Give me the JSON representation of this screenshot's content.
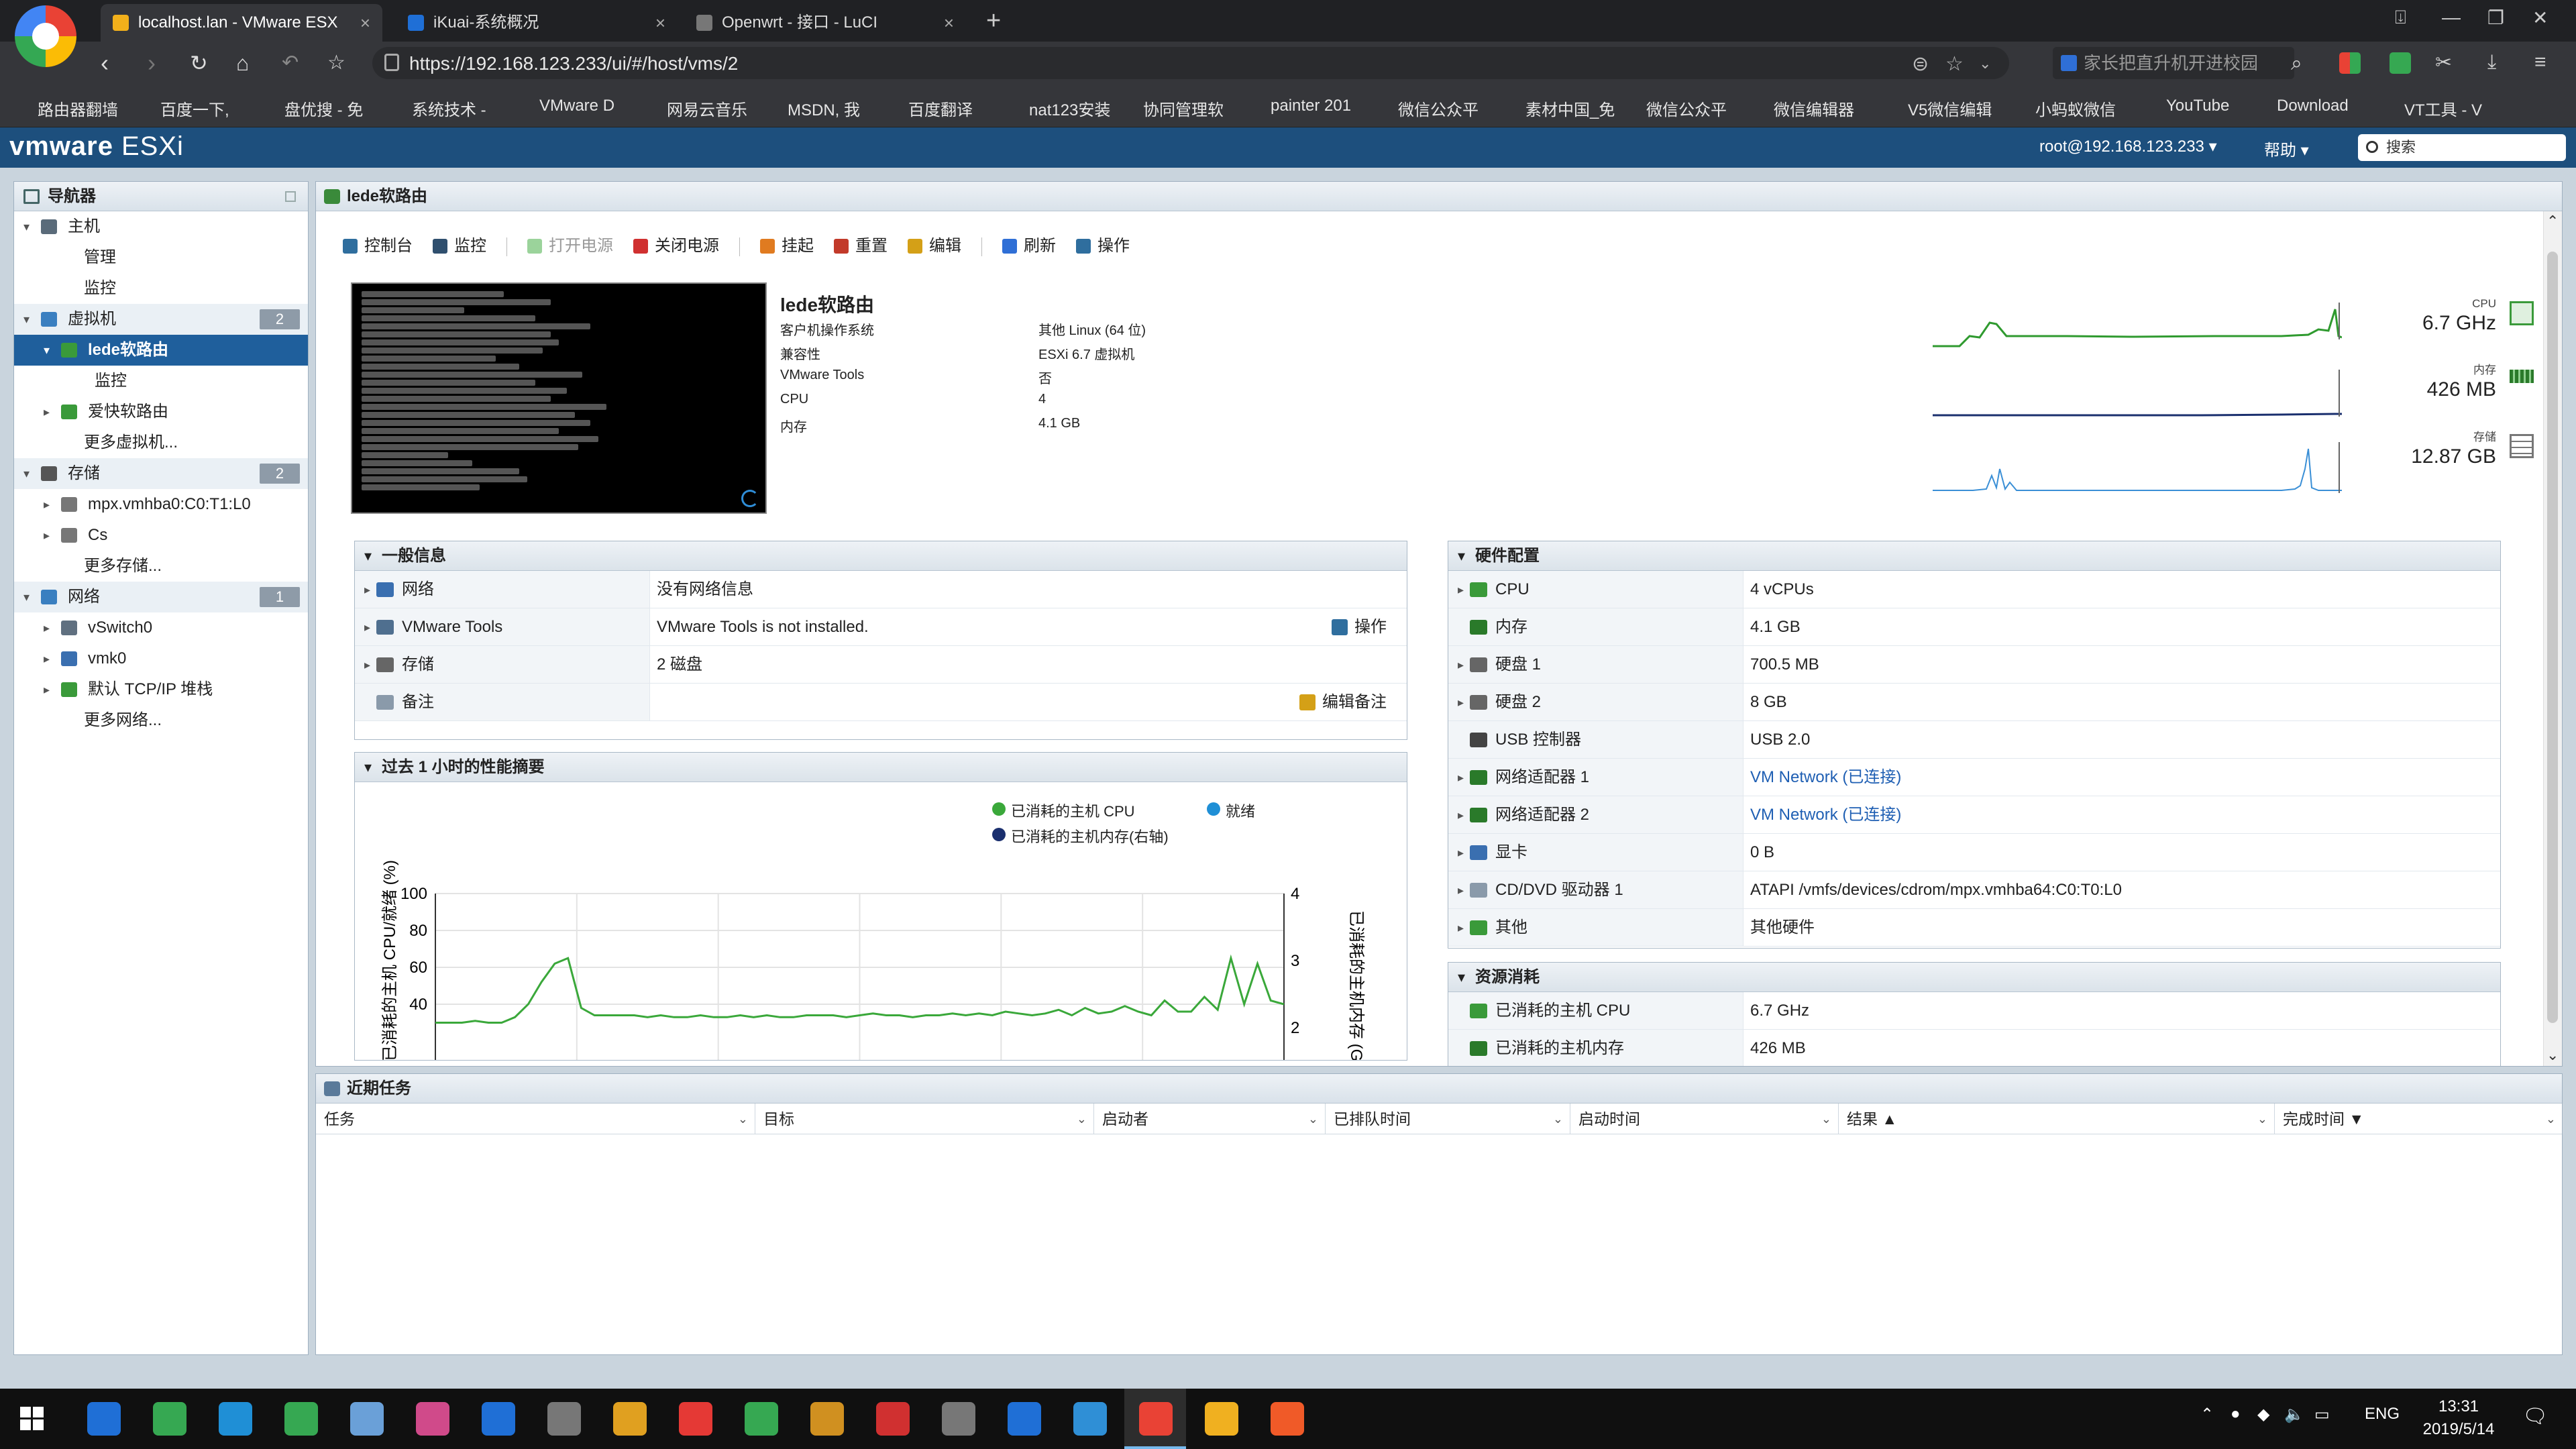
{
  "browser": {
    "tabs": [
      {
        "label": "localhost.lan - VMware ESX",
        "active": true
      },
      {
        "label": "iKuai-系统概况",
        "active": false
      },
      {
        "label": "Openwrt - 接口 - LuCI",
        "active": false
      }
    ],
    "url": "https://192.168.123.233/ui/#/host/vms/2",
    "search_placeholder": "家长把直升机开进校园",
    "bookmarks": [
      "路由器翻墙",
      "百度一下,",
      "盘优搜 - 免",
      "系统技术 -",
      "VMware D",
      "网易云音乐",
      "MSDN, 我",
      "百度翻译",
      "nat123安装",
      "协同管理软",
      "painter 201",
      "微信公众平",
      "素材中国_免",
      "微信公众平",
      "微信编辑器",
      "V5微信编辑",
      "小蚂蚁微信",
      "YouTube",
      "Download",
      "VT工具 - V"
    ],
    "bookmark_colors": [
      "#e8e8e8",
      "#2f6fd6",
      "#f2a31b",
      "#2f6fd6",
      "#888888",
      "#d0302f",
      "#f2a31b",
      "#2f6fd6",
      "#36a852",
      "#d0302f",
      "#2f6fd6",
      "#36a852",
      "#36a852",
      "#36a852",
      "#555555",
      "#2f6fd6",
      "#8bc34a",
      "#e53935",
      "#36a852",
      "#cccccc"
    ]
  },
  "esxi": {
    "logo_vm": "vmware",
    "logo_product": "ESXi",
    "user": "root@192.168.123.233 ▾",
    "help": "帮助 ▾",
    "search_placeholder": "搜索"
  },
  "navigator": {
    "title": "导航器",
    "items": [
      {
        "label": "主机",
        "level": 0,
        "arrow": "▾",
        "section": false,
        "badge": "",
        "icon_color": "#5a6b7a"
      },
      {
        "label": "管理",
        "level": 1,
        "arrow": "",
        "section": false,
        "badge": "",
        "icon_color": ""
      },
      {
        "label": "监控",
        "level": 1,
        "arrow": "",
        "section": false,
        "badge": "",
        "icon_color": ""
      },
      {
        "label": "虚拟机",
        "level": 0,
        "arrow": "▾",
        "section": true,
        "badge": "2",
        "icon_color": "#3a7fc0"
      },
      {
        "label": "lede软路由",
        "level": 1,
        "arrow": "▾",
        "section": false,
        "badge": "",
        "icon_color": "#3a9a3a",
        "selected": true
      },
      {
        "label": "监控",
        "level": 2,
        "arrow": "",
        "section": false,
        "badge": "",
        "icon_color": ""
      },
      {
        "label": "爱快软路由",
        "level": 1,
        "arrow": "▸",
        "section": false,
        "badge": "",
        "icon_color": "#3a9a3a"
      },
      {
        "label": "更多虚拟机...",
        "level": 1,
        "arrow": "",
        "section": false,
        "badge": "",
        "icon_color": ""
      },
      {
        "label": "存储",
        "level": 0,
        "arrow": "▾",
        "section": true,
        "badge": "2",
        "icon_color": "#555555"
      },
      {
        "label": "mpx.vmhba0:C0:T1:L0",
        "level": 1,
        "arrow": "▸",
        "section": false,
        "badge": "",
        "icon_color": "#777777"
      },
      {
        "label": "Cs",
        "level": 1,
        "arrow": "▸",
        "section": false,
        "badge": "",
        "icon_color": "#777777"
      },
      {
        "label": "更多存储...",
        "level": 1,
        "arrow": "",
        "section": false,
        "badge": "",
        "icon_color": ""
      },
      {
        "label": "网络",
        "level": 0,
        "arrow": "▾",
        "section": true,
        "badge": "1",
        "icon_color": "#3a7fc0"
      },
      {
        "label": "vSwitch0",
        "level": 1,
        "arrow": "▸",
        "section": false,
        "badge": "",
        "icon_color": "#607080"
      },
      {
        "label": "vmk0",
        "level": 1,
        "arrow": "▸",
        "section": false,
        "badge": "",
        "icon_color": "#3a6fb0"
      },
      {
        "label": "默认 TCP/IP 堆栈",
        "level": 1,
        "arrow": "▸",
        "section": false,
        "badge": "",
        "icon_color": "#3a9a3a"
      },
      {
        "label": "更多网络...",
        "level": 1,
        "arrow": "",
        "section": false,
        "badge": "",
        "icon_color": ""
      }
    ]
  },
  "vm": {
    "panel_title": "lede软路由",
    "actions": [
      {
        "label": "控制台",
        "icon": "console-icon",
        "color": "#2f6e9e",
        "disabled": false
      },
      {
        "label": "监控",
        "icon": "monitor-icon",
        "color": "#2f4f6e",
        "disabled": false
      },
      {
        "label": "打开电源",
        "icon": "power-on-icon",
        "color": "#9bd39b",
        "disabled": true
      },
      {
        "label": "关闭电源",
        "icon": "power-off-icon",
        "color": "#d03030",
        "disabled": false
      },
      {
        "label": "挂起",
        "icon": "suspend-icon",
        "color": "#e07b20",
        "disabled": false
      },
      {
        "label": "重置",
        "icon": "reset-icon",
        "color": "#c23a2a",
        "disabled": false
      },
      {
        "label": "编辑",
        "icon": "edit-icon",
        "color": "#d4a017",
        "disabled": false
      },
      {
        "label": "刷新",
        "icon": "refresh-icon",
        "color": "#2f6fd6",
        "disabled": false
      },
      {
        "label": "操作",
        "icon": "gear-icon",
        "color": "#2f6e9e",
        "disabled": false
      }
    ],
    "name": "lede软路由",
    "properties": [
      {
        "key": "客户机操作系统",
        "value": "其他 Linux (64 位)"
      },
      {
        "key": "兼容性",
        "value": "ESXi 6.7 虚拟机"
      },
      {
        "key": "VMware Tools",
        "value": "否"
      },
      {
        "key": "CPU",
        "value": "4"
      },
      {
        "key": "内存",
        "value": "4.1 GB"
      }
    ],
    "metrics": [
      {
        "label": "CPU",
        "value": "6.7 GHz"
      },
      {
        "label": "内存",
        "value": "426 MB"
      },
      {
        "label": "存储",
        "value": "12.87 GB"
      }
    ]
  },
  "general": {
    "title": "一般信息",
    "rows": [
      {
        "label": "网络",
        "value": "没有网络信息",
        "expander": "▸",
        "icon_color": "#3a6fb0",
        "action": ""
      },
      {
        "label": "VMware Tools",
        "value": "VMware Tools is not installed.",
        "expander": "▸",
        "icon_color": "#4f6f8f",
        "action": "操作"
      },
      {
        "label": "存储",
        "value": "2 磁盘",
        "expander": "▸",
        "icon_color": "#666666",
        "action": ""
      },
      {
        "label": "备注",
        "value": "",
        "expander": "",
        "icon_color": "#8a9aaa",
        "action": "编辑备注"
      }
    ]
  },
  "performance": {
    "title": "过去 1 小时的性能摘要",
    "legend": [
      {
        "label": "已消耗的主机 CPU",
        "color": "#3aa83a"
      },
      {
        "label": "就绪",
        "color": "#1f8fd6"
      },
      {
        "label": "已消耗的主机内存(右轴)",
        "color": "#1a2f6e"
      }
    ],
    "ylabel_left": "已消耗的主机 CPU/就绪 (%)",
    "ylabel_right": "已消耗的主机内存 (G"
  },
  "chart_data": {
    "type": "line",
    "title": "过去 1 小时的性能摘要",
    "ylabel": "已消耗的主机 CPU/就绪 (%)",
    "y2label": "已消耗的主机内存 (G",
    "ylim_visible": [
      30,
      100
    ],
    "y2lim_visible": [
      1,
      4
    ],
    "yticks": [
      "100",
      "80",
      "60",
      "40"
    ],
    "y2ticks": [
      "4",
      "3",
      "2"
    ],
    "grid": true,
    "legend_position": "top-right",
    "series": [
      {
        "name": "已消耗的主机 CPU",
        "axis": "left",
        "values": [
          30,
          30,
          30,
          31,
          30,
          30,
          33,
          40,
          52,
          62,
          65,
          38,
          34,
          34,
          34,
          34,
          33,
          34,
          33,
          33,
          34,
          33,
          33,
          34,
          33,
          34,
          33,
          33,
          34,
          34,
          34,
          33,
          34,
          35,
          34,
          34,
          33,
          34,
          34,
          35,
          34,
          35,
          34,
          36,
          35,
          34,
          35,
          37,
          34,
          38,
          35,
          36,
          39,
          36,
          34,
          42,
          36,
          36,
          44,
          37,
          65,
          40,
          62,
          42,
          40
        ]
      }
    ]
  },
  "hardware": {
    "title": "硬件配置",
    "rows": [
      {
        "label": "CPU",
        "value": "4 vCPUs",
        "expander": "▸",
        "icon_color": "#3a9a3a",
        "link": false
      },
      {
        "label": "内存",
        "value": "4.1 GB",
        "expander": "",
        "icon_color": "#2a7a2a",
        "link": false
      },
      {
        "label": "硬盘 1",
        "value": "700.5 MB",
        "expander": "▸",
        "icon_color": "#666666",
        "link": false
      },
      {
        "label": "硬盘 2",
        "value": "8 GB",
        "expander": "▸",
        "icon_color": "#666666",
        "link": false
      },
      {
        "label": "USB 控制器",
        "value": "USB 2.0",
        "expander": "",
        "icon_color": "#444444",
        "link": false
      },
      {
        "label": "网络适配器 1",
        "value": "VM Network (已连接)",
        "expander": "▸",
        "icon_color": "#2a7a2a",
        "link": true
      },
      {
        "label": "网络适配器 2",
        "value": "VM Network (已连接)",
        "expander": "▸",
        "icon_color": "#2a7a2a",
        "link": true
      },
      {
        "label": "显卡",
        "value": "0 B",
        "expander": "▸",
        "icon_color": "#3a6fb0",
        "link": false
      },
      {
        "label": "CD/DVD 驱动器 1",
        "value": "ATAPI /vmfs/devices/cdrom/mpx.vmhba64:C0:T0:L0",
        "expander": "▸",
        "icon_color": "#8a9aaa",
        "link": false
      },
      {
        "label": "其他",
        "value": "其他硬件",
        "expander": "▸",
        "icon_color": "#3a9a3a",
        "link": false
      }
    ]
  },
  "resources": {
    "title": "资源消耗",
    "rows": [
      {
        "label": "已消耗的主机 CPU",
        "value": "6.7 GHz",
        "icon_color": "#3a9a3a"
      },
      {
        "label": "已消耗的主机内存",
        "value": "426 MB",
        "icon_color": "#2a7a2a"
      }
    ]
  },
  "tasks": {
    "title": "近期任务",
    "columns": [
      "任务",
      "目标",
      "启动者",
      "已排队时间",
      "启动时间",
      "结果 ▲",
      "完成时间 ▼"
    ]
  },
  "taskbar": {
    "lang": "ENG",
    "time": "13:31",
    "date": "2019/5/14",
    "icon_colors": [
      "#1f6fd6",
      "#36a852",
      "#1f8fd6",
      "#36a852",
      "#6aa0d8",
      "#d04a8a",
      "#1f6fd6",
      "#777777",
      "#e0a020",
      "#e53935",
      "#36a852",
      "#d09020",
      "#d03030",
      "#777777",
      "#1f6fd6",
      "#2f8fd6",
      "#e94235",
      "#f0b020",
      "#f05a28"
    ]
  }
}
